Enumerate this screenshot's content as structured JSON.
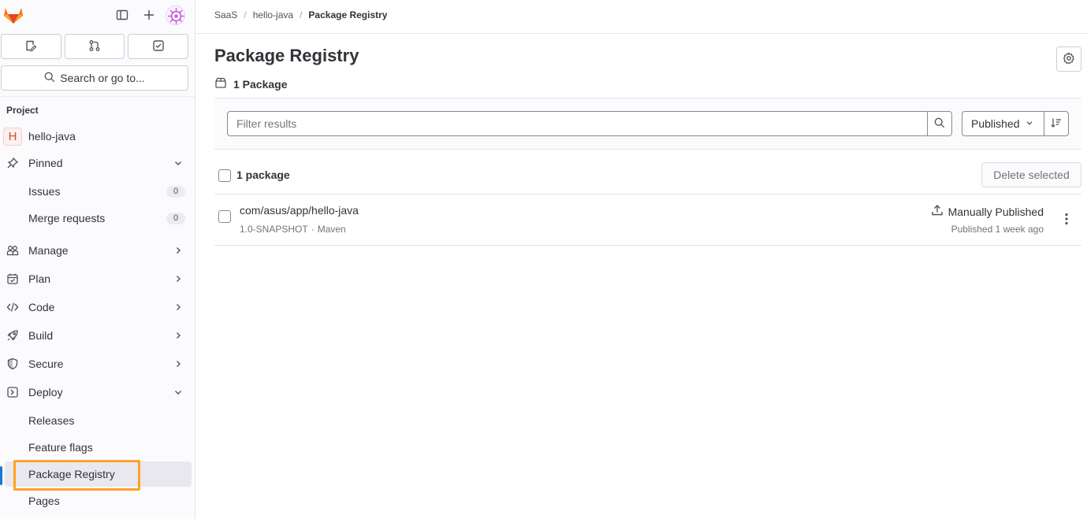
{
  "sidebar": {
    "icons": {
      "logo": "gitlab-tanuki-icon",
      "panel": "sidebar-panel-icon",
      "new": "plus-icon",
      "avatar": "user-avatar",
      "issues": "issues-icon",
      "merge_requests": "merge-request-icon",
      "todos": "todo-icon",
      "search": "search-icon"
    },
    "search_label": "Search or go to...",
    "section_label": "Project",
    "project_initial": "H",
    "project_name": "hello-java",
    "pinned": {
      "label": "Pinned",
      "items": [
        {
          "label": "Issues",
          "count": "0"
        },
        {
          "label": "Merge requests",
          "count": "0"
        }
      ]
    },
    "groups": [
      {
        "label": "Manage",
        "icon": "users-icon"
      },
      {
        "label": "Plan",
        "icon": "calendar-icon"
      },
      {
        "label": "Code",
        "icon": "code-icon"
      },
      {
        "label": "Build",
        "icon": "rocket-icon"
      },
      {
        "label": "Secure",
        "icon": "shield-icon"
      },
      {
        "label": "Deploy",
        "icon": "deployments-icon"
      }
    ],
    "deploy_items": [
      "Releases",
      "Feature flags",
      "Package Registry",
      "Pages"
    ],
    "active_item": "Package Registry"
  },
  "breadcrumb": [
    "SaaS",
    "hello-java",
    "Package Registry"
  ],
  "page": {
    "title": "Package Registry",
    "package_count_label": "1 Package"
  },
  "filter": {
    "placeholder": "Filter results",
    "sort_label": "Published"
  },
  "list": {
    "header_label": "1 package",
    "delete_label": "Delete selected",
    "packages": [
      {
        "name": "com/asus/app/hello-java",
        "version": "1.0-SNAPSHOT",
        "separator": "·",
        "type": "Maven",
        "status": "Manually Published",
        "published": "Published 1 week ago"
      }
    ]
  },
  "colors": {
    "accent_blue": "#1f75cb",
    "highlight_orange": "#fca326",
    "gitlab_orange": "#e24329"
  }
}
